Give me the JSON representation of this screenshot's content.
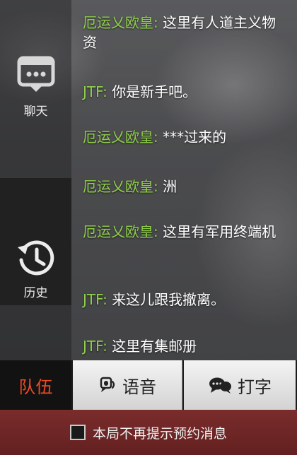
{
  "sidebar": {
    "chat_label": "聊天",
    "history_label": "历史"
  },
  "messages": [
    {
      "sender": "厄运乂欧皇",
      "sep": ": ",
      "text": "这里有人道主义物资"
    },
    {
      "sender": "JTF",
      "sep": ": ",
      "text": "你是新手吧。"
    },
    {
      "sender": "厄运乂欧皇",
      "sep": ": ",
      "text": "***过来的"
    },
    {
      "sender": "厄运乂欧皇",
      "sep": ": ",
      "text": "洲"
    },
    {
      "sender": "厄运乂欧皇",
      "sep": ": ",
      "text": "这里有军用终端机"
    },
    {
      "sender": "JTF",
      "sep": ": ",
      "text": "来这儿跟我撤离。"
    },
    {
      "sender": "JTF",
      "sep": ": ",
      "text": "这里有集邮册"
    }
  ],
  "tabs": {
    "team": "队伍",
    "voice": "语音",
    "type": "打字"
  },
  "notice": {
    "text": "本局不再提示预约消息"
  },
  "colors": {
    "sender": "#8fcf48",
    "team_tab": "#f04a24",
    "notice_bg": "#6e2626"
  },
  "icons": {
    "chat": "chat-bubble-icon",
    "history": "history-clock-icon",
    "voice": "voice-mic-icon",
    "type": "keyboard-chat-icon"
  }
}
